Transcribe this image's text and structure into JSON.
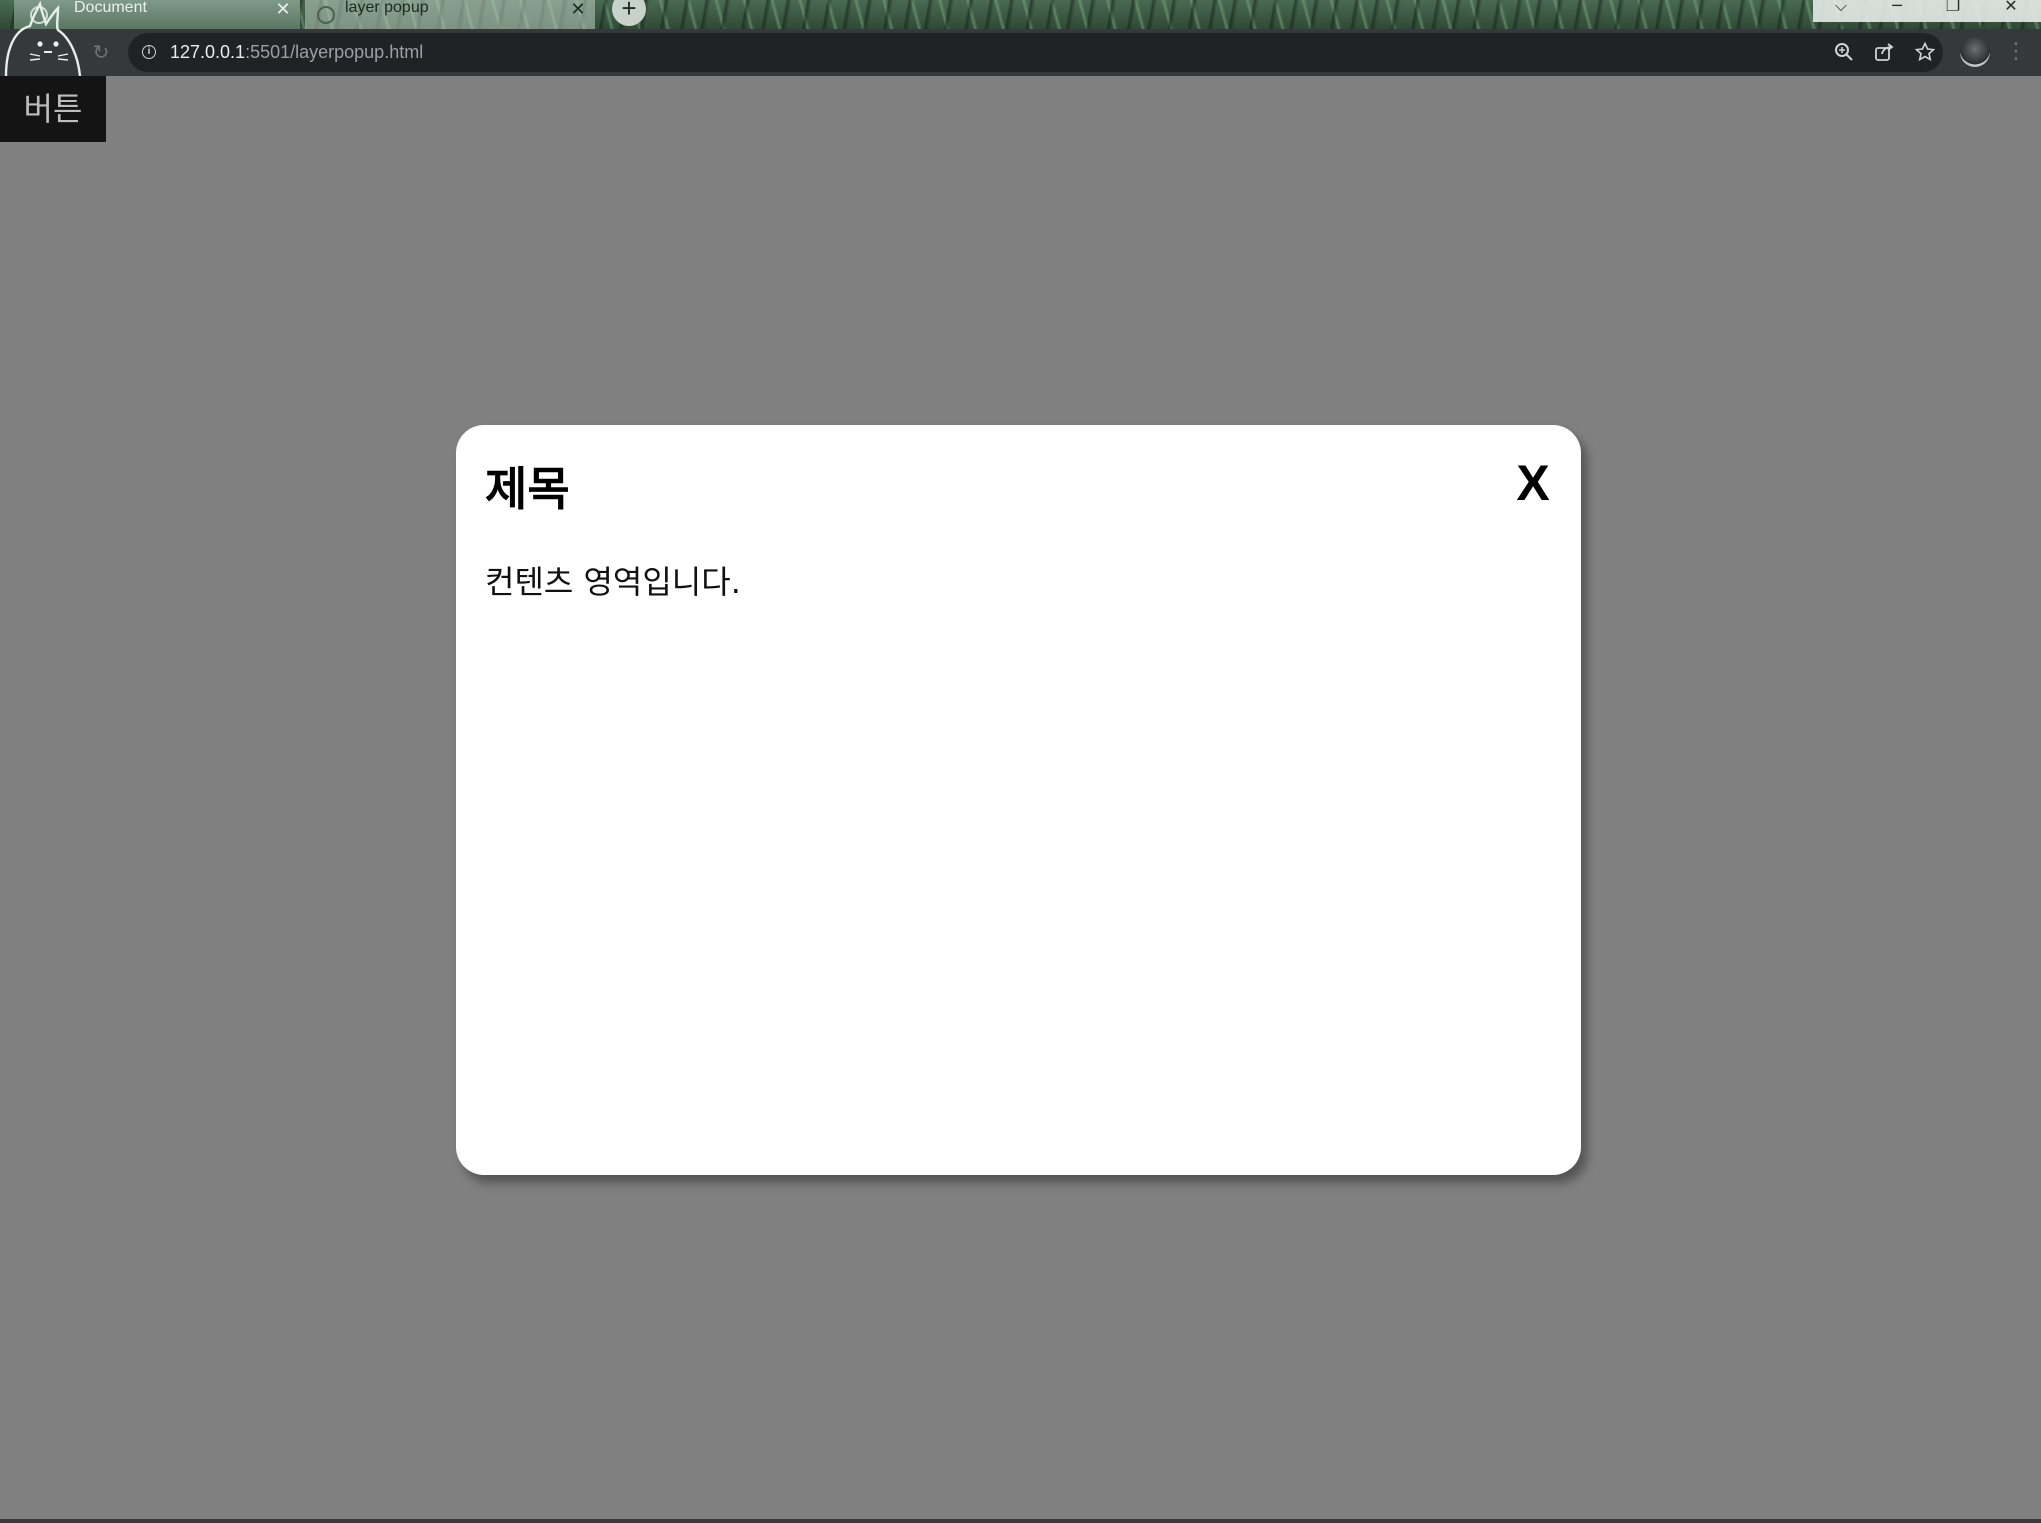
{
  "browser": {
    "tabs": [
      {
        "title": "Document",
        "close": "✕",
        "active": true
      },
      {
        "title": "layer popup",
        "close": "✕",
        "active": false
      }
    ],
    "new_tab": "+",
    "window_controls": {
      "dropdown": "⌵",
      "minimize": "─",
      "restore": "❐",
      "close": "✕"
    },
    "address": {
      "host": "127.0.0.1",
      "path": ":5501/layerpopup.html"
    },
    "icons": [
      "info-icon",
      "reload-icon",
      "zoom-icon",
      "share-icon",
      "star-icon",
      "profile-avatar",
      "menu-icon"
    ]
  },
  "page": {
    "button_label": "버튼"
  },
  "popup": {
    "title": "제목",
    "close_label": "X",
    "content": "컨텐츠 영역입니다."
  },
  "colors": {
    "overlay": "#808080",
    "popup_bg": "#ffffff",
    "button_bg": "#141414",
    "toolbar_bg": "#35393b"
  }
}
